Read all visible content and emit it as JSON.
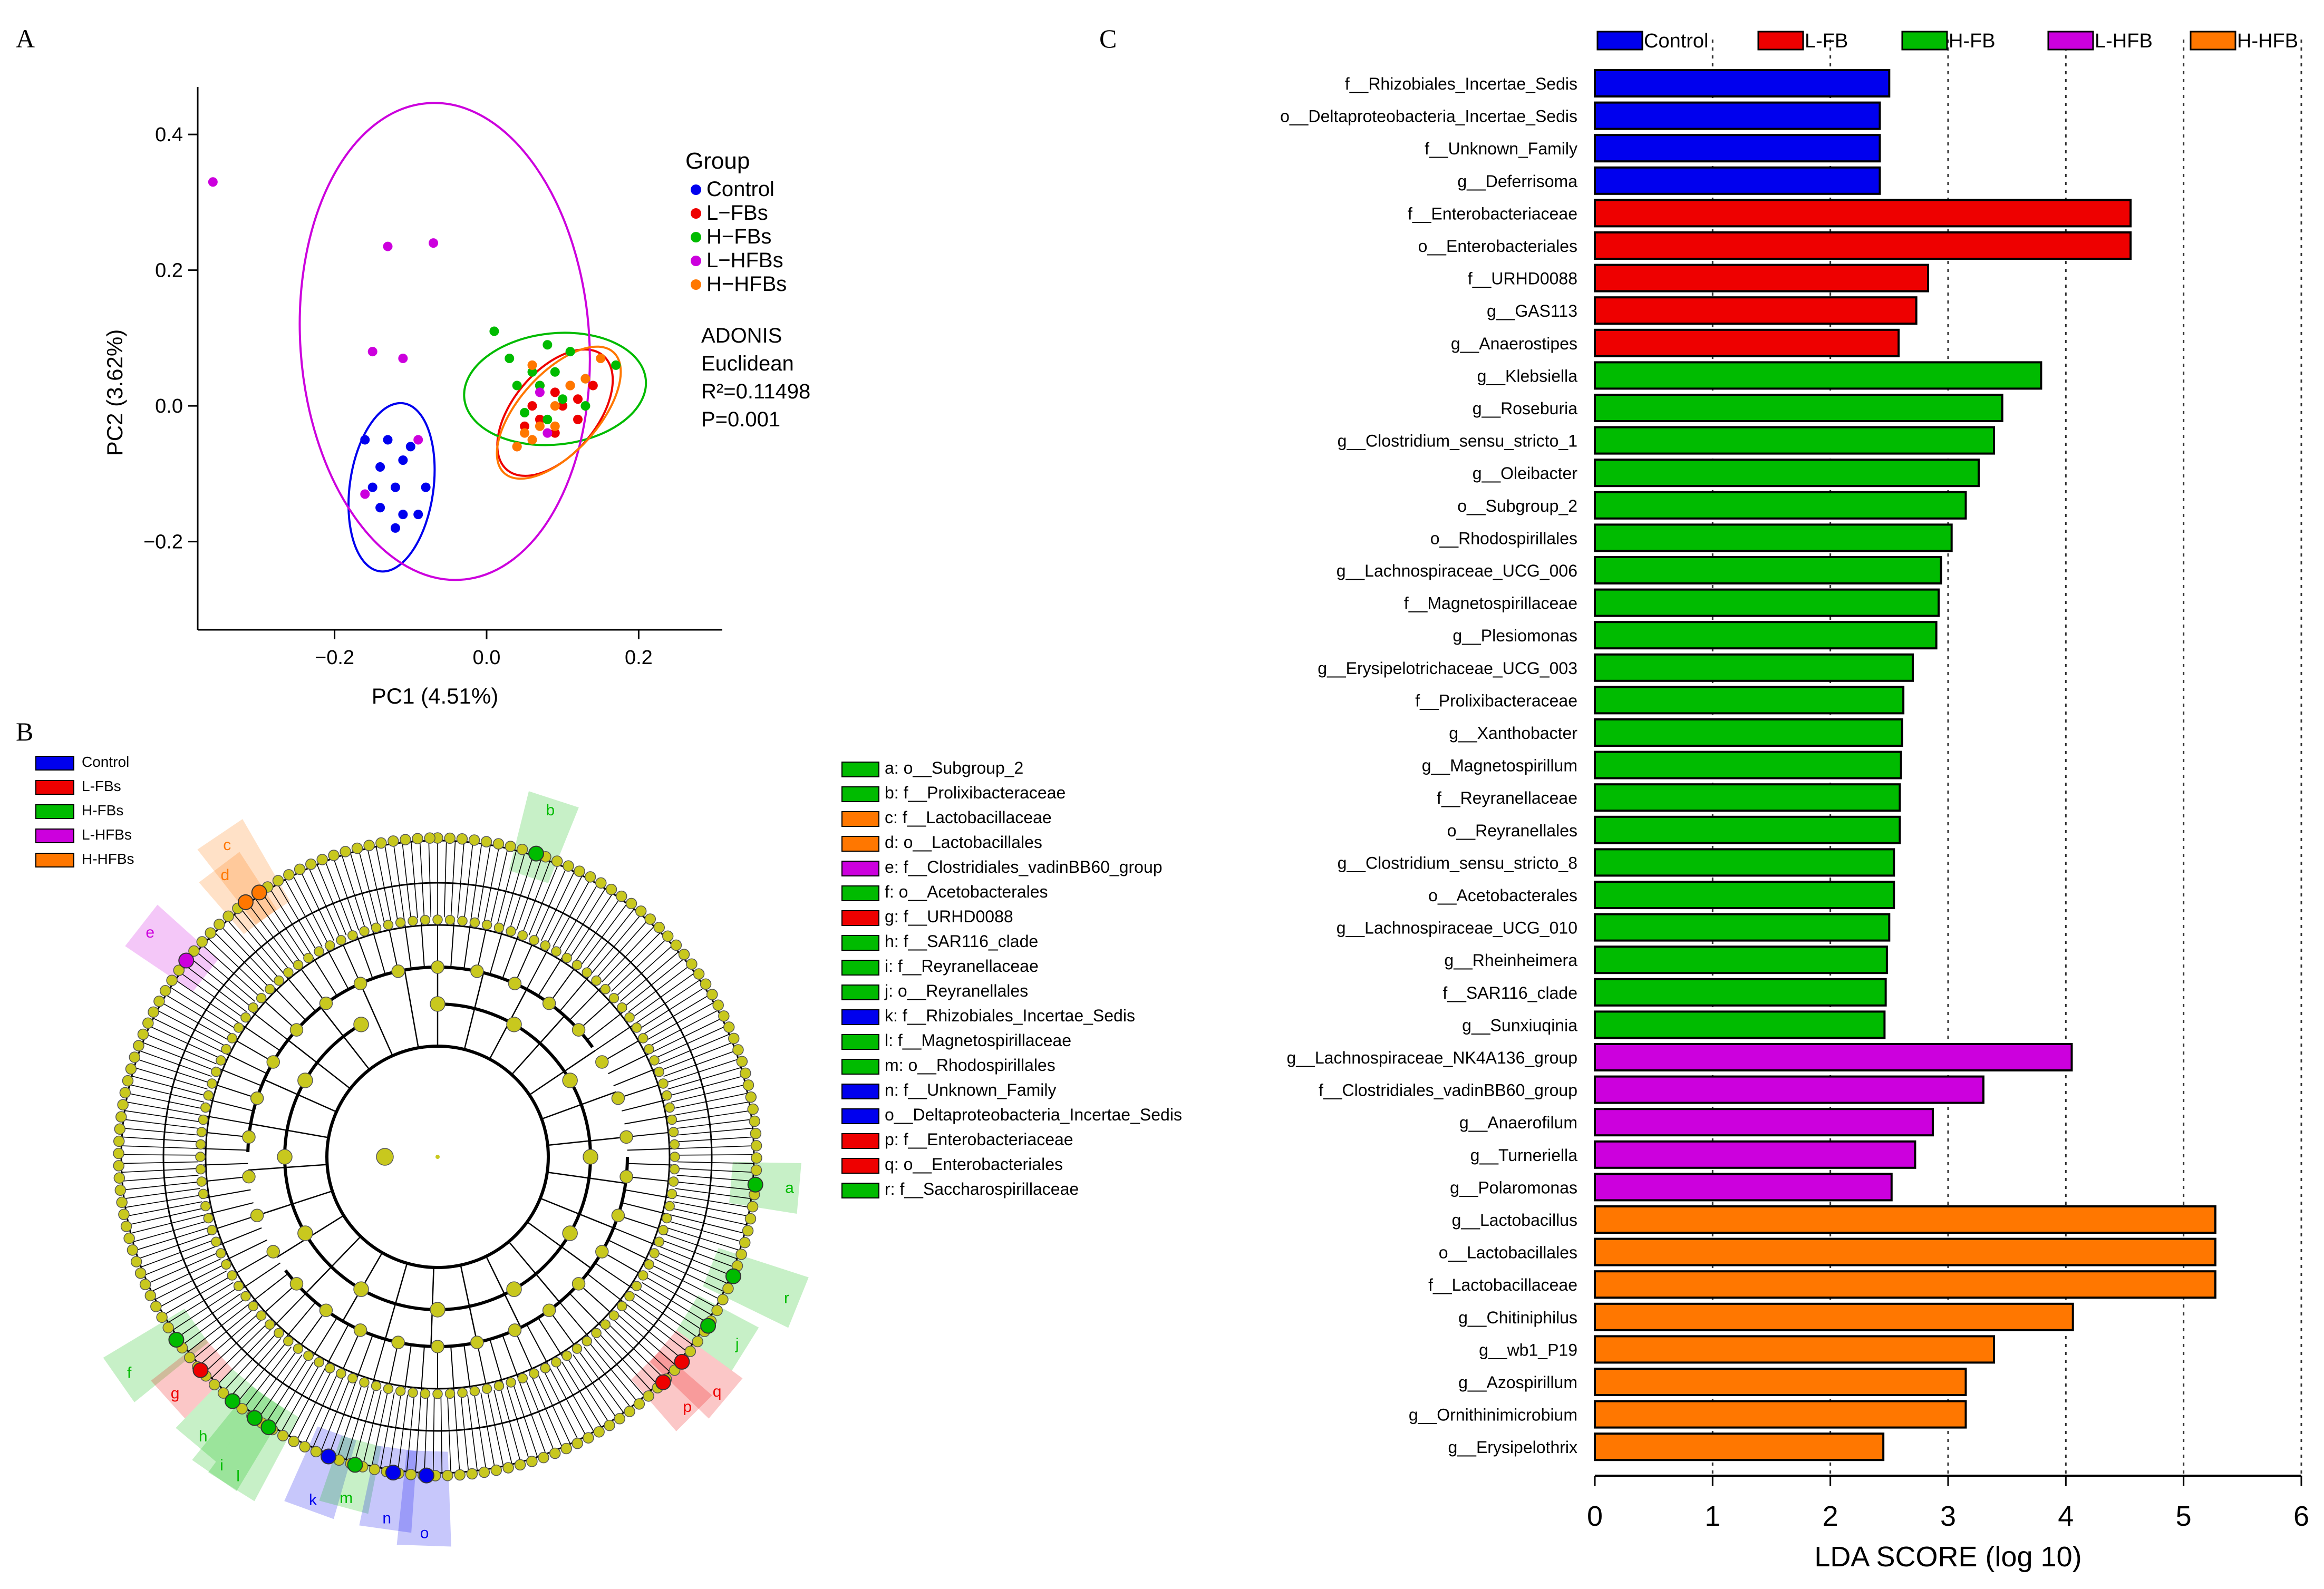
{
  "panels": {
    "A": "A",
    "B": "B",
    "C": "C"
  },
  "colors": {
    "control": "#0000ee",
    "lfb": "#ee0000",
    "hfb": "#00bb00",
    "lhfb": "#cc00dd",
    "hhfb": "#ff7700",
    "node": "#c8c81e"
  },
  "chart_data": [
    {
      "type": "scatter",
      "xlabel": "PC1 (4.51%)",
      "ylabel": "PC2 (3.62%)",
      "xlim": [
        -0.38,
        0.31
      ],
      "ylim": [
        -0.33,
        0.47
      ],
      "xticks": [
        -0.2,
        0.0,
        0.2
      ],
      "xtick_labels": [
        "−0.2",
        "0.0",
        "0.2"
      ],
      "yticks": [
        -0.2,
        0.0,
        0.2,
        0.4
      ],
      "ytick_labels": [
        "−0.2",
        "0.0",
        "0.2",
        "0.4"
      ],
      "legend_title": "Group",
      "legend_position": "right",
      "annotation": [
        "ADONIS",
        "Euclidean",
        "R²=0.11498",
        "P=0.001"
      ],
      "series": [
        {
          "name": "Control",
          "color": "#0000ee",
          "points": [
            [
              -0.16,
              -0.05
            ],
            [
              -0.13,
              -0.05
            ],
            [
              -0.1,
              -0.06
            ],
            [
              -0.14,
              -0.09
            ],
            [
              -0.11,
              -0.08
            ],
            [
              -0.08,
              -0.12
            ],
            [
              -0.15,
              -0.12
            ],
            [
              -0.12,
              -0.12
            ],
            [
              -0.14,
              -0.15
            ],
            [
              -0.11,
              -0.16
            ],
            [
              -0.09,
              -0.16
            ],
            [
              -0.12,
              -0.18
            ]
          ],
          "ellipse": {
            "cx": -0.125,
            "cy": -0.12,
            "rx": 0.055,
            "ry": 0.125,
            "angle": 8
          }
        },
        {
          "name": "L−FBs",
          "color": "#ee0000",
          "points": [
            [
              0.07,
              0.03
            ],
            [
              0.11,
              0.03
            ],
            [
              0.14,
              0.03
            ],
            [
              0.09,
              0.02
            ],
            [
              0.12,
              0.01
            ],
            [
              0.06,
              0.0
            ],
            [
              0.1,
              0.0
            ],
            [
              0.07,
              -0.02
            ],
            [
              0.12,
              -0.02
            ],
            [
              0.05,
              -0.03
            ],
            [
              0.09,
              -0.04
            ],
            [
              0.04,
              -0.06
            ]
          ],
          "ellipse": {
            "cx": 0.09,
            "cy": -0.01,
            "rx": 0.055,
            "ry": 0.11,
            "angle": 40
          }
        },
        {
          "name": "H−FBs",
          "color": "#00bb00",
          "points": [
            [
              0.01,
              0.11
            ],
            [
              0.08,
              0.09
            ],
            [
              0.11,
              0.08
            ],
            [
              0.03,
              0.07
            ],
            [
              0.06,
              0.05
            ],
            [
              0.09,
              0.05
            ],
            [
              0.17,
              0.06
            ],
            [
              0.13,
              0.04
            ],
            [
              0.04,
              0.03
            ],
            [
              0.07,
              0.03
            ],
            [
              0.1,
              0.01
            ],
            [
              0.13,
              0.0
            ],
            [
              0.05,
              -0.01
            ],
            [
              0.08,
              -0.02
            ]
          ],
          "ellipse": {
            "cx": 0.09,
            "cy": 0.025,
            "rx": 0.12,
            "ry": 0.082,
            "angle": -6
          }
        },
        {
          "name": "L−HFBs",
          "color": "#cc00dd",
          "points": [
            [
              -0.36,
              0.33
            ],
            [
              -0.13,
              0.235
            ],
            [
              -0.07,
              0.24
            ],
            [
              -0.15,
              0.08
            ],
            [
              -0.11,
              0.07
            ],
            [
              -0.09,
              -0.05
            ],
            [
              -0.16,
              -0.13
            ],
            [
              0.08,
              -0.04
            ],
            [
              0.07,
              0.02
            ]
          ],
          "ellipse": {
            "cx": -0.055,
            "cy": 0.095,
            "rx": 0.19,
            "ry": 0.352,
            "angle": -4
          }
        },
        {
          "name": "H−HFBs",
          "color": "#ff7700",
          "points": [
            [
              0.06,
              0.06
            ],
            [
              0.15,
              0.07
            ],
            [
              0.13,
              0.04
            ],
            [
              0.11,
              0.03
            ],
            [
              0.09,
              0.0
            ],
            [
              0.07,
              -0.03
            ],
            [
              0.09,
              -0.03
            ],
            [
              0.05,
              -0.04
            ],
            [
              0.06,
              -0.05
            ],
            [
              0.04,
              -0.06
            ]
          ],
          "ellipse": {
            "cx": 0.095,
            "cy": -0.01,
            "rx": 0.052,
            "ry": 0.12,
            "angle": 42
          }
        }
      ]
    },
    {
      "type": "cladogram",
      "legend": [
        {
          "name": "Control",
          "color": "#0000ee"
        },
        {
          "name": "L-FBs",
          "color": "#ee0000"
        },
        {
          "name": "H-FBs",
          "color": "#00bb00"
        },
        {
          "name": "L-HFBs",
          "color": "#cc00dd"
        },
        {
          "name": "H-HFBs",
          "color": "#ff7700"
        }
      ],
      "taxa": [
        {
          "key": "a",
          "label": "a: o__Subgroup_2",
          "color": "#00bb00",
          "angle": 95
        },
        {
          "key": "b",
          "label": "b: f__Prolixibacteraceae",
          "color": "#00bb00",
          "angle": 18
        },
        {
          "key": "c",
          "label": "c: f__Lactobacillaceae",
          "color": "#ff7700",
          "angle": -34
        },
        {
          "key": "d",
          "label": "d: o__Lactobacillales",
          "color": "#ff7700",
          "angle": -37
        },
        {
          "key": "e",
          "label": "e: f__Clostridiales_vadinBB60_group",
          "color": "#cc00dd",
          "angle": -52
        },
        {
          "key": "f",
          "label": "f: o__Acetobacterales",
          "color": "#00bb00",
          "angle": -125
        },
        {
          "key": "g",
          "label": "g: f__URHD0088",
          "color": "#ee0000",
          "angle": -132
        },
        {
          "key": "h",
          "label": "h: f__SAR116_clade",
          "color": "#00bb00",
          "angle": -140
        },
        {
          "key": "i",
          "label": "i: f__Reyranellaceae",
          "color": "#00bb00",
          "angle": -145
        },
        {
          "key": "j",
          "label": "j: o__Reyranellales",
          "color": "#00bb00",
          "angle": 122
        },
        {
          "key": "k",
          "label": "k: f__Rhizobiales_Incertae_Sedis",
          "color": "#0000ee",
          "angle": -160
        },
        {
          "key": "l",
          "label": "l: f__Magnetospirillaceae",
          "color": "#00bb00",
          "angle": -148
        },
        {
          "key": "m",
          "label": "m: o__Rhodospirillales",
          "color": "#00bb00",
          "angle": -165
        },
        {
          "key": "n",
          "label": "n: f__Unknown_Family",
          "color": "#0000ee",
          "angle": -172
        },
        {
          "key": "o",
          "label": "o__Deltaproteobacteria_Incertae_Sedis",
          "color": "#0000ee",
          "angle": -178
        },
        {
          "key": "p",
          "label": "p: f__Enterobacteriaceae",
          "color": "#ee0000",
          "angle": 135
        },
        {
          "key": "q",
          "label": "q: o__Enterobacteriales",
          "color": "#ee0000",
          "angle": 130
        },
        {
          "key": "r",
          "label": "r: f__Saccharospirillaceae",
          "color": "#00bb00",
          "angle": 112
        }
      ]
    },
    {
      "type": "bar",
      "orientation": "horizontal",
      "xlabel": "LDA SCORE (log 10)",
      "xlim": [
        0,
        6
      ],
      "xticks": [
        0,
        1,
        2,
        3,
        4,
        5,
        6
      ],
      "legend_position": "top",
      "legend": [
        {
          "name": "Control",
          "color": "#0000ee"
        },
        {
          "name": "L-FB",
          "color": "#ee0000"
        },
        {
          "name": "H-FB",
          "color": "#00bb00"
        },
        {
          "name": "L-HFB",
          "color": "#cc00dd"
        },
        {
          "name": "H-HFB",
          "color": "#ff7700"
        }
      ],
      "bars": [
        {
          "label": "f__Rhizobiales_Incertae_Sedis",
          "value": 2.5,
          "group": 0
        },
        {
          "label": "o__Deltaproteobacteria_Incertae_Sedis",
          "value": 2.42,
          "group": 0
        },
        {
          "label": "f__Unknown_Family",
          "value": 2.42,
          "group": 0
        },
        {
          "label": "g__Deferrisoma",
          "value": 2.42,
          "group": 0
        },
        {
          "label": "f__Enterobacteriaceae",
          "value": 4.55,
          "group": 1
        },
        {
          "label": "o__Enterobacteriales",
          "value": 4.55,
          "group": 1
        },
        {
          "label": "f__URHD0088",
          "value": 2.83,
          "group": 1
        },
        {
          "label": "g__GAS113",
          "value": 2.73,
          "group": 1
        },
        {
          "label": "g__Anaerostipes",
          "value": 2.58,
          "group": 1
        },
        {
          "label": "g__Klebsiella",
          "value": 3.79,
          "group": 2
        },
        {
          "label": "g__Roseburia",
          "value": 3.46,
          "group": 2
        },
        {
          "label": "g__Clostridium_sensu_stricto_1",
          "value": 3.39,
          "group": 2
        },
        {
          "label": "g__Oleibacter",
          "value": 3.26,
          "group": 2
        },
        {
          "label": "o__Subgroup_2",
          "value": 3.15,
          "group": 2
        },
        {
          "label": "o__Rhodospirillales",
          "value": 3.03,
          "group": 2
        },
        {
          "label": "g__Lachnospiraceae_UCG_006",
          "value": 2.94,
          "group": 2
        },
        {
          "label": "f__Magnetospirillaceae",
          "value": 2.92,
          "group": 2
        },
        {
          "label": "g__Plesiomonas",
          "value": 2.9,
          "group": 2
        },
        {
          "label": "g__Erysipelotrichaceae_UCG_003",
          "value": 2.7,
          "group": 2
        },
        {
          "label": "f__Prolixibacteraceae",
          "value": 2.62,
          "group": 2
        },
        {
          "label": "g__Xanthobacter",
          "value": 2.61,
          "group": 2
        },
        {
          "label": "g__Magnetospirillum",
          "value": 2.6,
          "group": 2
        },
        {
          "label": "f__Reyranellaceae",
          "value": 2.59,
          "group": 2
        },
        {
          "label": "o__Reyranellales",
          "value": 2.59,
          "group": 2
        },
        {
          "label": "g__Clostridium_sensu_stricto_8",
          "value": 2.54,
          "group": 2
        },
        {
          "label": "o__Acetobacterales",
          "value": 2.54,
          "group": 2
        },
        {
          "label": "g__Lachnospiraceae_UCG_010",
          "value": 2.5,
          "group": 2
        },
        {
          "label": "g__Rheinheimera",
          "value": 2.48,
          "group": 2
        },
        {
          "label": "f__SAR116_clade",
          "value": 2.47,
          "group": 2
        },
        {
          "label": "g__Sunxiuqinia",
          "value": 2.46,
          "group": 2
        },
        {
          "label": "g__Lachnospiraceae_NK4A136_group",
          "value": 4.05,
          "group": 3
        },
        {
          "label": "f__Clostridiales_vadinBB60_group",
          "value": 3.3,
          "group": 3
        },
        {
          "label": "g__Anaerofilum",
          "value": 2.87,
          "group": 3
        },
        {
          "label": "g__Turneriella",
          "value": 2.72,
          "group": 3
        },
        {
          "label": "g__Polaromonas",
          "value": 2.52,
          "group": 3
        },
        {
          "label": "g__Lactobacillus",
          "value": 5.27,
          "group": 4
        },
        {
          "label": "o__Lactobacillales",
          "value": 5.27,
          "group": 4
        },
        {
          "label": "f__Lactobacillaceae",
          "value": 5.27,
          "group": 4
        },
        {
          "label": "g__Chitiniphilus",
          "value": 4.06,
          "group": 4
        },
        {
          "label": "g__wb1_P19",
          "value": 3.39,
          "group": 4
        },
        {
          "label": "g__Azospirillum",
          "value": 3.15,
          "group": 4
        },
        {
          "label": "g__Ornithinimicrobium",
          "value": 3.15,
          "group": 4
        },
        {
          "label": "g__Erysipelothrix",
          "value": 2.45,
          "group": 4
        }
      ]
    }
  ]
}
